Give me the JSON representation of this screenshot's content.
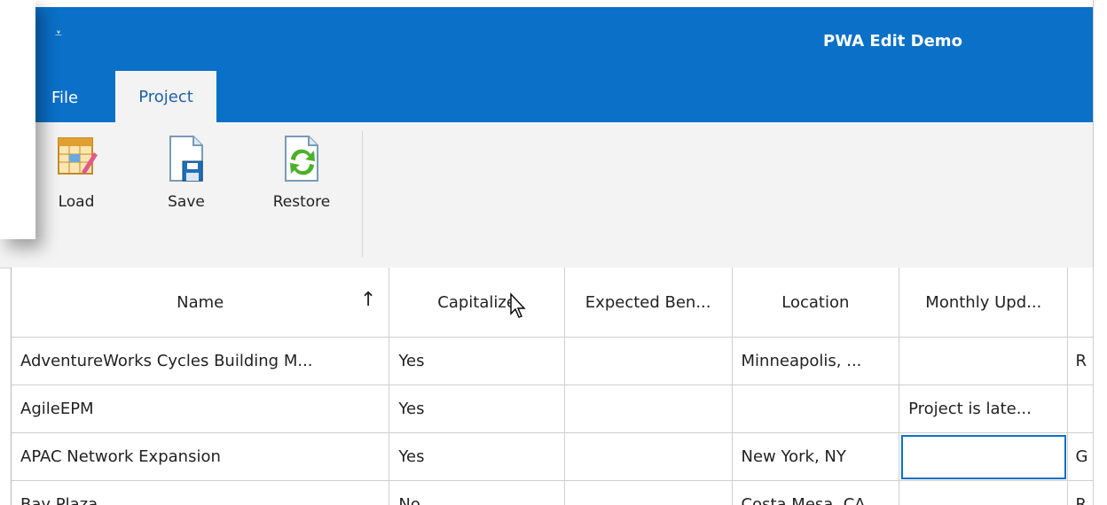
{
  "window": {
    "title": "PWA Edit Demo",
    "accent_color": "#0a70c8"
  },
  "qat": {
    "glyph": "⩡"
  },
  "tabs": [
    {
      "label": "File"
    },
    {
      "label": "Project"
    }
  ],
  "ribbon": {
    "load_label": "Load",
    "save_label": "Save",
    "restore_label": "Restore"
  },
  "grid": {
    "columns": [
      "Name",
      "Capitalize",
      "Expected Ben...",
      "Location",
      "Monthly Upd..."
    ],
    "sort_glyph": "↑",
    "rows": [
      {
        "name": "AdventureWorks Cycles Building M...",
        "capitalize": "Yes",
        "expected": "",
        "location": "Minneapolis, ...",
        "monthly": "",
        "rest": "R"
      },
      {
        "name": "AgileEPM",
        "capitalize": "Yes",
        "expected": "",
        "location": "",
        "monthly": "Project is late...",
        "rest": ""
      },
      {
        "name": "APAC Network Expansion",
        "capitalize": "Yes",
        "expected": "",
        "location": "New York, NY",
        "monthly": "",
        "rest": "G"
      },
      {
        "name": "Bay Plaza",
        "capitalize": "No",
        "expected": "",
        "location": "Costa Mesa, CA",
        "monthly": "",
        "rest": "R"
      }
    ]
  }
}
